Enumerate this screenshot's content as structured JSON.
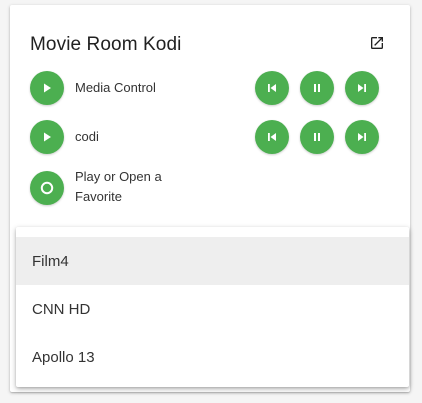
{
  "card": {
    "title": "Movie Room Kodi",
    "open_icon": "open-in-new-icon"
  },
  "rows": [
    {
      "label": "Media Control",
      "play_icon": "play-icon",
      "controls": [
        "skip-previous-icon",
        "pause-icon",
        "skip-next-icon"
      ]
    },
    {
      "label": "codi",
      "play_icon": "play-icon",
      "controls": [
        "skip-previous-icon",
        "pause-icon",
        "skip-next-icon"
      ]
    },
    {
      "label": "Play or Open a Favorite",
      "play_icon": "circle-outline-icon",
      "controls": []
    }
  ],
  "dropdown": {
    "items": [
      "Film4",
      "CNN HD",
      "Apollo 13"
    ],
    "selected": "Film4"
  },
  "colors": {
    "accent": "#4caf50",
    "selected_bg": "#eeeeee"
  }
}
